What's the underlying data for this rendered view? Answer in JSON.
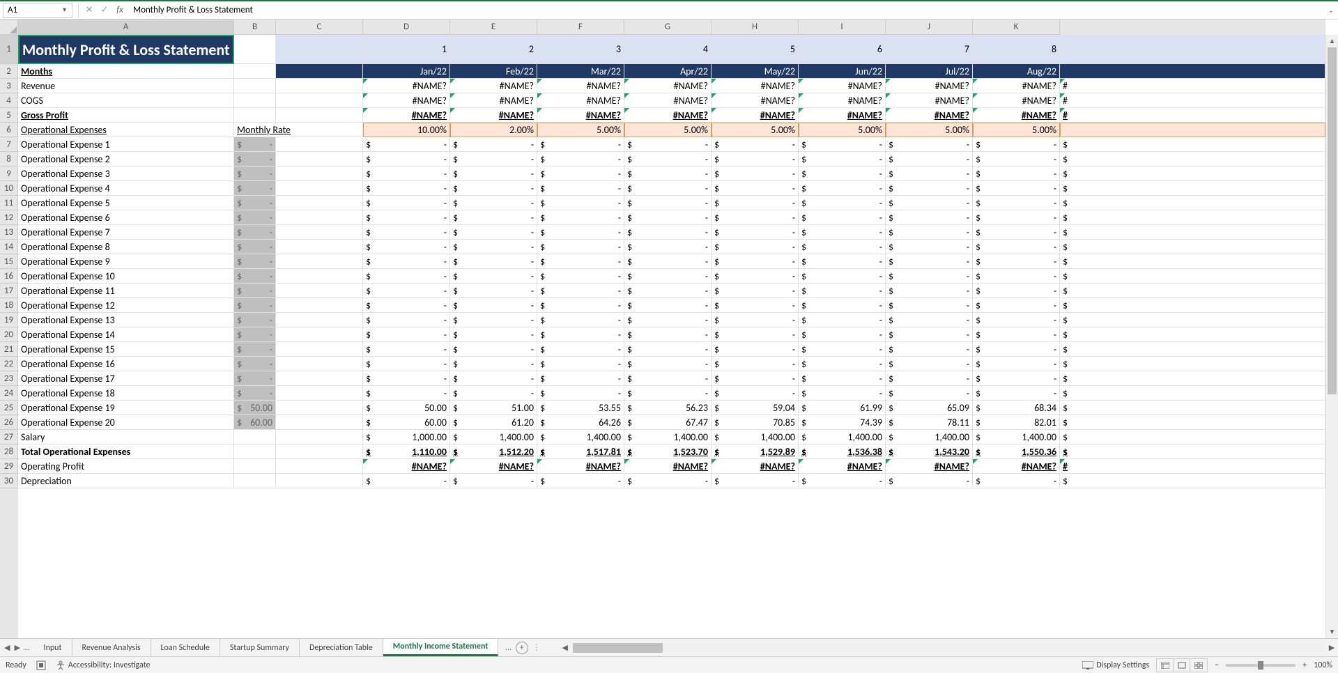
{
  "nameBox": "A1",
  "formula": "Monthly Profit & Loss Statement",
  "columns": [
    "A",
    "B",
    "C",
    "D",
    "E",
    "F",
    "G",
    "H",
    "I",
    "J",
    "K"
  ],
  "colWidths": {
    "A": 310,
    "B": 60,
    "C": 125,
    "D": 125,
    "E": 125,
    "F": 125,
    "G": 125,
    "H": 125,
    "I": 125,
    "J": 125,
    "K": 125
  },
  "rowNums": [
    1,
    2,
    3,
    4,
    5,
    6,
    7,
    8,
    9,
    10,
    11,
    12,
    13,
    14,
    15,
    16,
    17,
    18,
    19,
    20,
    21,
    22,
    23,
    24,
    25,
    26,
    27,
    28,
    29,
    30
  ],
  "title": "Monthly Profit & Loss Statement",
  "periodNums": [
    "1",
    "2",
    "3",
    "4",
    "5",
    "6",
    "7",
    "8"
  ],
  "monthsLabel": "Months",
  "months": [
    "Jan/22",
    "Feb/22",
    "Mar/22",
    "Apr/22",
    "May/22",
    "Jun/22",
    "Jul/22",
    "Aug/22"
  ],
  "rowLabels": {
    "revenue": "Revenue",
    "cogs": "COGS",
    "gross": "Gross Profit",
    "opex": "Operational Expenses",
    "rate": "Monthly Rate",
    "salary": "Salary",
    "total": "Total Operational Expenses",
    "opprofit": "Operating Profit",
    "depr": "Depreciation"
  },
  "opexNames": [
    "Operational Expense 1",
    "Operational Expense 2",
    "Operational Expense 3",
    "Operational Expense 4",
    "Operational Expense 5",
    "Operational Expense 6",
    "Operational Expense 7",
    "Operational Expense 8",
    "Operational Expense 9",
    "Operational Expense 10",
    "Operational Expense 11",
    "Operational Expense 12",
    "Operational Expense 13",
    "Operational Expense 14",
    "Operational Expense 15",
    "Operational Expense 16",
    "Operational Expense 17",
    "Operational Expense 18",
    "Operational Expense 19",
    "Operational Expense 20"
  ],
  "rates": [
    "10.00%",
    "2.00%",
    "5.00%",
    "5.00%",
    "5.00%",
    "5.00%",
    "5.00%",
    "5.00%"
  ],
  "nameErr": "#NAME?",
  "dollar": "$",
  "dash": "-",
  "monthlyRates": [
    "-",
    "-",
    "-",
    "-",
    "-",
    "-",
    "-",
    "-",
    "-",
    "-",
    "-",
    "-",
    "-",
    "-",
    "-",
    "-",
    "-",
    "-",
    "50.00",
    "60.00"
  ],
  "opexVals": {
    "19": [
      "50.00",
      "51.00",
      "53.55",
      "56.23",
      "59.04",
      "61.99",
      "65.09",
      "68.34"
    ],
    "20": [
      "60.00",
      "61.20",
      "64.26",
      "67.47",
      "70.85",
      "74.39",
      "78.11",
      "82.01"
    ]
  },
  "salaryVals": [
    "1,000.00",
    "1,400.00",
    "1,400.00",
    "1,400.00",
    "1,400.00",
    "1,400.00",
    "1,400.00",
    "1,400.00"
  ],
  "totalVals": [
    "1,110.00",
    "1,512.20",
    "1,517.81",
    "1,523.70",
    "1,529.89",
    "1,536.38",
    "1,543.20",
    "1,550.36"
  ],
  "edgeChar": "#",
  "tabs": [
    "Input",
    "Revenue Analysis",
    "Loan Schedule",
    "Startup Summary",
    "Depreciation Table",
    "Monthly Income Statement"
  ],
  "activeTab": 5,
  "status": {
    "ready": "Ready",
    "access": "Accessibility: Investigate",
    "display": "Display Settings",
    "zoom": "100%"
  }
}
